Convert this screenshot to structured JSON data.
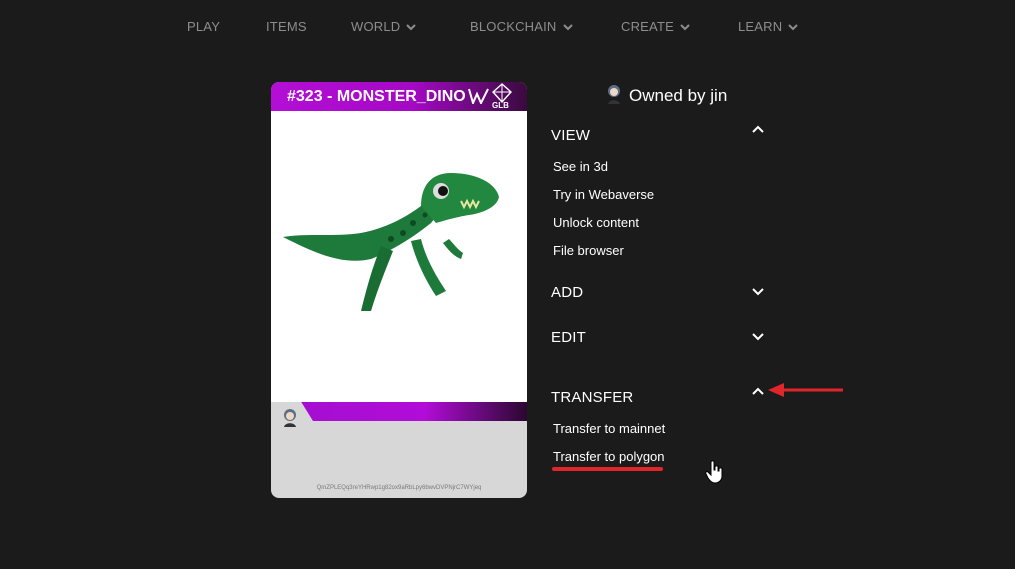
{
  "nav": {
    "items": [
      {
        "label": "PLAY"
      },
      {
        "label": "ITEMS"
      },
      {
        "label": "WORLD"
      },
      {
        "label": "BLOCKCHAIN"
      },
      {
        "label": "CREATE"
      },
      {
        "label": "LEARN"
      }
    ]
  },
  "card": {
    "title": "#323 - MONSTER_DINO",
    "format_label": "GLB",
    "hash": "QmZPLEQq3reYHRwp1g82ox9aRbLpy6bwvDVPNjrC7WYjeq",
    "image_icon": "green-dinosaur-icon",
    "colors": {
      "header": "#b40ed6",
      "body": "#d7d7d7"
    }
  },
  "owner": {
    "text": "Owned by jin",
    "avatar_icon": "user-avatar-icon"
  },
  "sections": {
    "view": {
      "title": "VIEW",
      "expanded": true,
      "links": [
        "See in 3d",
        "Try in Webaverse",
        "Unlock content",
        "File browser"
      ]
    },
    "add": {
      "title": "ADD",
      "expanded": false
    },
    "edit": {
      "title": "EDIT",
      "expanded": false
    },
    "transfer": {
      "title": "TRANSFER",
      "expanded": true,
      "links": [
        "Transfer to mainnet",
        "Transfer to polygon"
      ]
    }
  },
  "annotations": {
    "arrow_color": "#e0262a",
    "underline_color": "#e0262a"
  }
}
